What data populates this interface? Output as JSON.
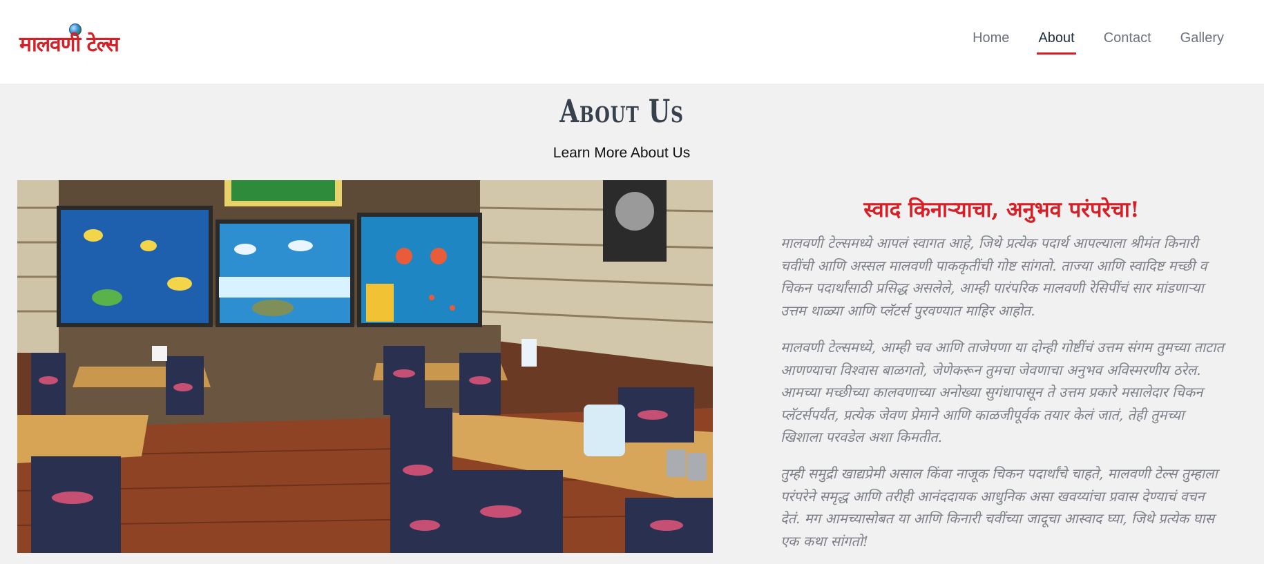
{
  "header": {
    "logo_text": "मालवणी टेल्स",
    "nav": [
      {
        "label": "Home",
        "active": false
      },
      {
        "label": "About",
        "active": true
      },
      {
        "label": "Contact",
        "active": false
      },
      {
        "label": "Gallery",
        "active": false
      }
    ]
  },
  "about": {
    "title": "About Us",
    "subtitle": "Learn More About Us",
    "heading": "स्वाद किनाऱ्याचा, अनुभव परंपरेचा!",
    "paragraphs": [
      "मालवणी टेल्समध्ये आपलं स्वागत आहे, जिथे प्रत्येक पदार्थ आपल्याला श्रीमंत किनारी चवींची आणि अस्सल मालवणी पाककृतींची गोष्ट सांगतो. ताज्या आणि स्वादिष्ट मच्छी व चिकन पदार्थांसाठी प्रसिद्ध असलेले, आम्ही पारंपरिक मालवणी रेसिपींचं सार मांडणाऱ्या उत्तम थाळ्या आणि प्लॅटर्स पुरवण्यात माहिर आहोत.",
      "मालवणी टेल्समध्ये, आम्ही चव आणि ताजेपणा या दोन्ही गोष्टींचं उत्तम संगम तुमच्या ताटात आणण्याचा विश्वास बाळगतो, जेणेकरून तुमचा जेवणाचा अनुभव अविस्मरणीय ठरेल. आमच्या मच्छीच्या कालवणाच्या अनोख्या सुगंधापासून ते उत्तम प्रकारे मसालेदार चिकन प्लॅटर्सपर्यंत, प्रत्येक जेवण प्रेमाने आणि काळजीपूर्वक तयार केलं जातं, तेही तुमच्या खिशाला परवडेल अशा किमतीत.",
      "तुम्ही समुद्री खाद्यप्रेमी असाल किंवा नाजूक चिकन पदार्थांचे चाहते, मालवणी टेल्स तुम्हाला परंपरेने समृद्ध आणि तरीही आनंददायक आधुनिक असा खवय्यांचा प्रवास देण्याचं वचन देतं. मग आमच्यासोबत या आणि किनारी चवींच्या जादूचा आस्वाद घ्या, जिथे प्रत्येक घास एक कथा सांगतो!"
    ]
  },
  "colors": {
    "brand_red": "#d62027",
    "nav_text": "#6c7280",
    "paragraph_text": "#7d8088",
    "page_bg": "#f1f1f1"
  },
  "icons": {
    "logo_globe": "globe-icon"
  }
}
